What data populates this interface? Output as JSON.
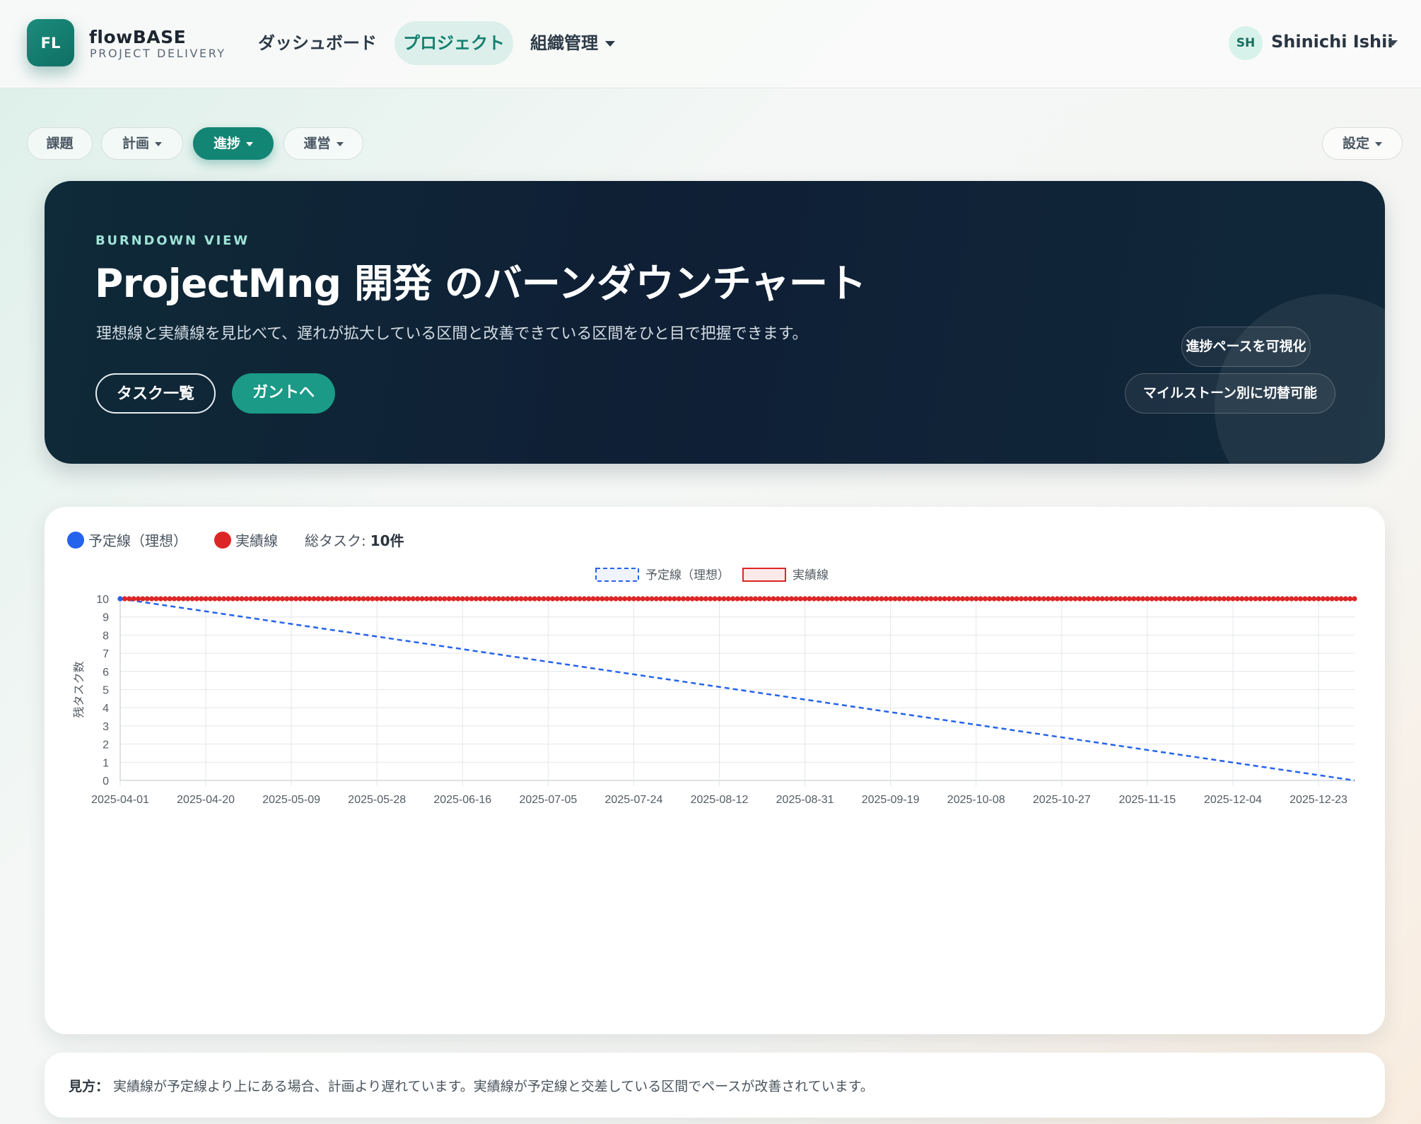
{
  "header": {
    "logo_text": "FL",
    "brand_name": "flowBASE",
    "brand_sub": "PROJECT DELIVERY",
    "nav": {
      "dashboard": "ダッシュボード",
      "projects": "プロジェクト",
      "org": "組織管理"
    },
    "user": {
      "initials": "SH",
      "name": "Shinichi Ishii"
    }
  },
  "subnav": {
    "issues": "課題",
    "plan": "計画",
    "progress": "進捗",
    "ops": "運営",
    "settings": "設定",
    "active": "progress"
  },
  "hero": {
    "eyebrow": "BURNDOWN VIEW",
    "title": "ProjectMng 開発 のバーンダウンチャート",
    "description": "理想線と実績線を見比べて、遅れが拡大している区間と改善できている区間をひと目で把握できます。",
    "btn_tasks": "タスク一覧",
    "btn_gantt": "ガントへ",
    "chip_pace": "進捗ペースを可視化",
    "chip_milestone": "マイルストーン別に切替可能"
  },
  "summary": {
    "ideal_label": "予定線（理想）",
    "actual_label": "実績線",
    "total_label": "総タスク:",
    "total_value": "10件"
  },
  "note": {
    "label": "見方：",
    "text": "実績線が予定線より上にある場合、計画より遅れています。実績線が予定線と交差している区間でペースが改善されています。"
  },
  "colors": {
    "accent": "#138574",
    "ideal": "#2563eb",
    "actual": "#dc2626",
    "hero_bg": "#0f1f35"
  },
  "chart_data": {
    "type": "line",
    "title": "",
    "xlabel": "",
    "ylabel": "残タスク数",
    "ylim": [
      0,
      10
    ],
    "yticks": [
      0,
      1,
      2,
      3,
      4,
      5,
      6,
      7,
      8,
      9,
      10
    ],
    "x_start": "2025-04-01",
    "x_end": "2025-12-31",
    "xticks": [
      "2025-04-01",
      "2025-04-20",
      "2025-05-09",
      "2025-05-28",
      "2025-06-16",
      "2025-07-05",
      "2025-07-24",
      "2025-08-12",
      "2025-08-31",
      "2025-09-19",
      "2025-10-08",
      "2025-10-27",
      "2025-11-15",
      "2025-12-04",
      "2025-12-23"
    ],
    "grid": true,
    "legend_position": "top-center",
    "series": [
      {
        "name": "予定線（理想）",
        "style": "dashed",
        "color": "#2563eb",
        "points": [
          [
            "2025-04-01",
            10
          ],
          [
            "2025-12-31",
            0
          ]
        ]
      },
      {
        "name": "実績線",
        "style": "solid-markers",
        "color": "#dc2626",
        "points": [
          [
            "2025-04-01",
            10
          ],
          [
            "2025-12-31",
            10
          ]
        ]
      }
    ]
  }
}
